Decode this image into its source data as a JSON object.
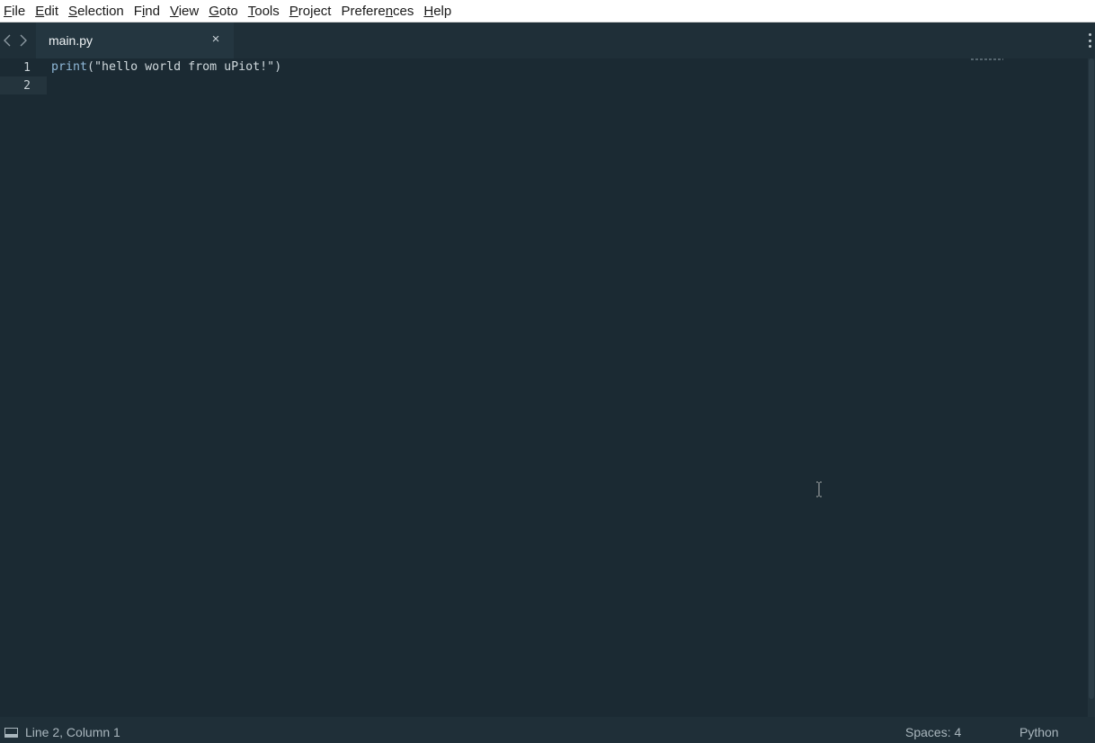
{
  "menubar": {
    "items": [
      {
        "pre": "",
        "key": "F",
        "post": "ile"
      },
      {
        "pre": "",
        "key": "E",
        "post": "dit"
      },
      {
        "pre": "",
        "key": "S",
        "post": "election"
      },
      {
        "pre": "F",
        "key": "i",
        "post": "nd"
      },
      {
        "pre": "",
        "key": "V",
        "post": "iew"
      },
      {
        "pre": "",
        "key": "G",
        "post": "oto"
      },
      {
        "pre": "",
        "key": "T",
        "post": "ools"
      },
      {
        "pre": "",
        "key": "P",
        "post": "roject"
      },
      {
        "pre": "Prefere",
        "key": "n",
        "post": "ces"
      },
      {
        "pre": "",
        "key": "H",
        "post": "elp"
      }
    ]
  },
  "tabs": {
    "back_icon": "chevron-left-icon",
    "forward_icon": "chevron-right-icon",
    "active_tab": {
      "label": "main.py",
      "close_glyph": "×"
    },
    "overflow_icon": "more-vertical-icon"
  },
  "editor": {
    "line_numbers": [
      "1",
      "2"
    ],
    "lines": [
      {
        "fn": "print",
        "open": "(",
        "str": "\"hello world from uPiot!\"",
        "close": ")"
      }
    ],
    "colors": {
      "background": "#1b2a33",
      "function": "#8fb8d8",
      "string": "#cfd8dc"
    }
  },
  "status": {
    "panel_icon": "console-panel-icon",
    "position": "Line 2, Column 1",
    "spaces": "Spaces: 4",
    "syntax": "Python"
  }
}
